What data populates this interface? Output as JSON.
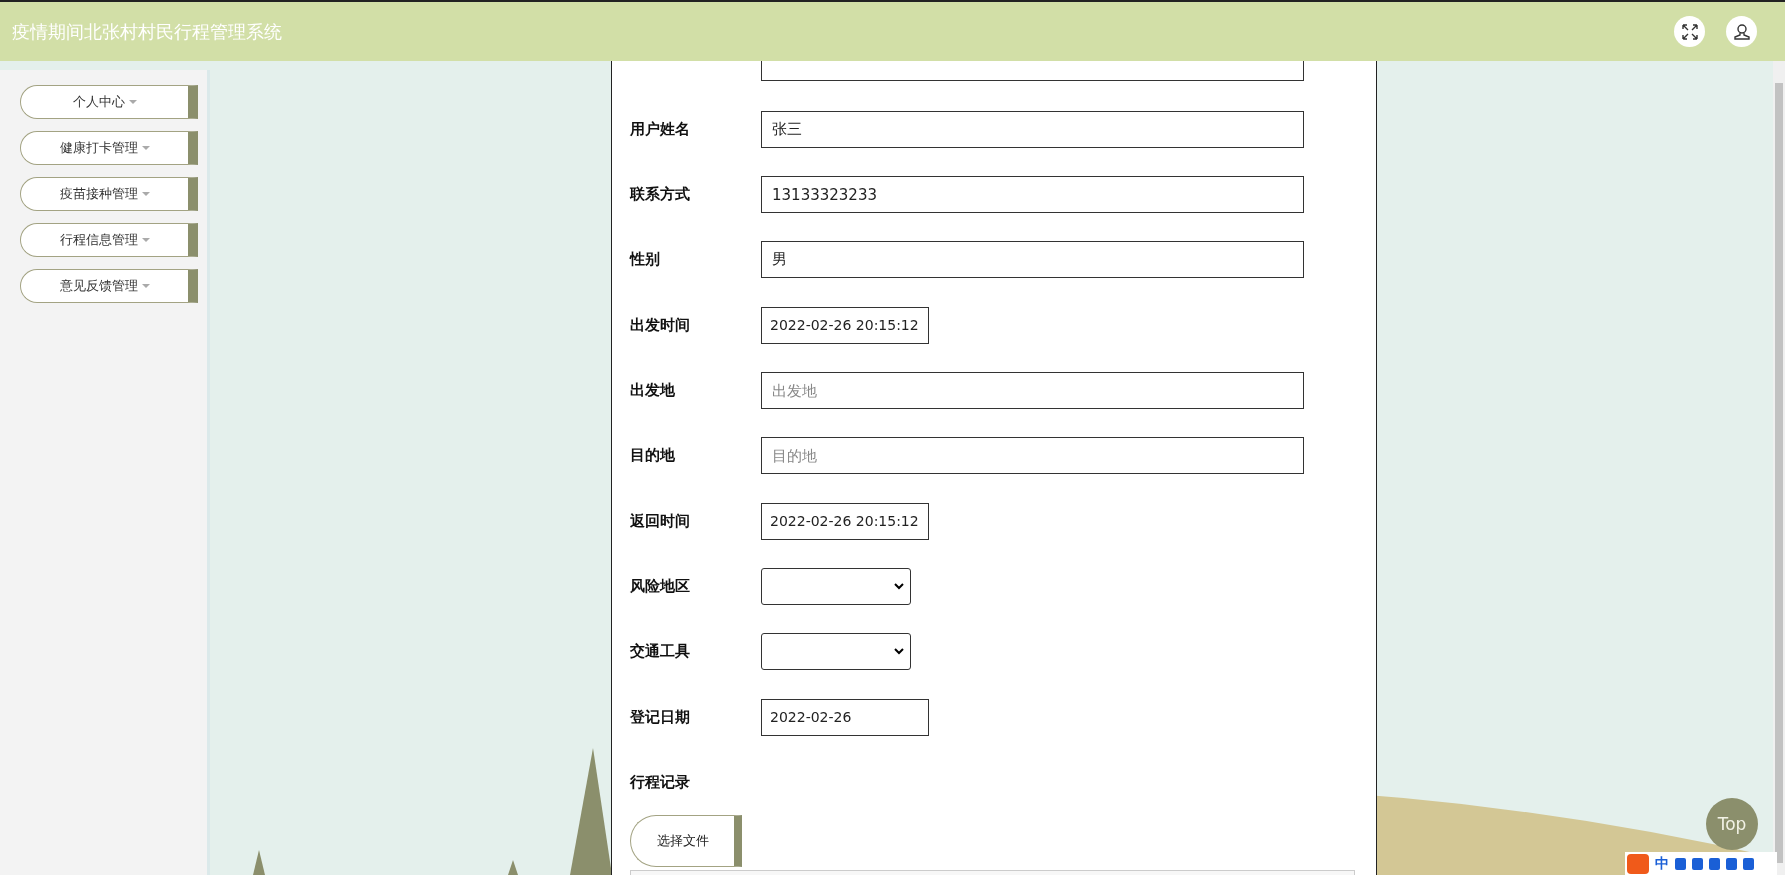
{
  "header": {
    "title": "疫情期间北张村村民行程管理系统"
  },
  "sidebar": {
    "items": [
      {
        "label": "个人中心"
      },
      {
        "label": "健康打卡管理"
      },
      {
        "label": "疫苗接种管理"
      },
      {
        "label": "行程信息管理"
      },
      {
        "label": "意见反馈管理"
      }
    ]
  },
  "form": {
    "fields": [
      {
        "label": "用户姓名",
        "kind": "text",
        "value": "张三"
      },
      {
        "label": "联系方式",
        "kind": "text",
        "value": "13133323233"
      },
      {
        "label": "性别",
        "kind": "text",
        "value": "男"
      },
      {
        "label": "出发时间",
        "kind": "date",
        "value": "2022-02-26 20:15:12"
      },
      {
        "label": "出发地",
        "kind": "text",
        "placeholder": "出发地"
      },
      {
        "label": "目的地",
        "kind": "text",
        "placeholder": "目的地"
      },
      {
        "label": "返回时间",
        "kind": "date",
        "value": "2022-02-26 20:15:12"
      },
      {
        "label": "风险地区",
        "kind": "select"
      },
      {
        "label": "交通工具",
        "kind": "select"
      },
      {
        "label": "登记日期",
        "kind": "date",
        "value": "2022-02-26"
      }
    ],
    "upload": {
      "label": "行程记录",
      "button": "选择文件"
    }
  },
  "top_button": "Top",
  "ime_bar": {
    "mode": "中"
  }
}
